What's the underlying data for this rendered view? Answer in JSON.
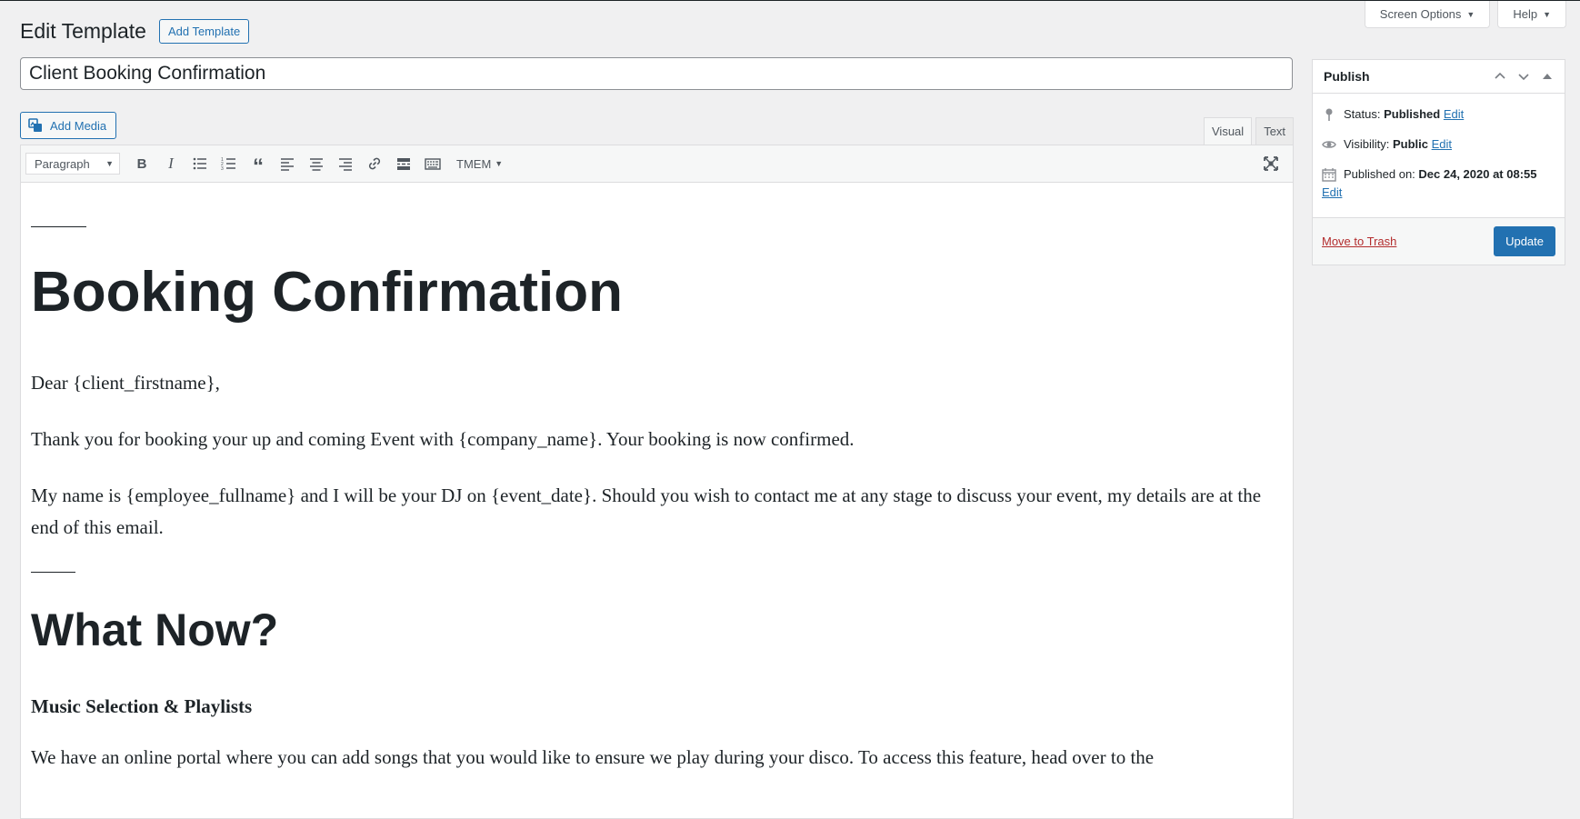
{
  "screen_meta": {
    "screen_options": "Screen Options",
    "help": "Help"
  },
  "header": {
    "title": "Edit Template",
    "add_new": "Add Template"
  },
  "post_title": "Client Booking Confirmation",
  "editor": {
    "add_media": "Add Media",
    "tabs": {
      "visual": "Visual",
      "text": "Text"
    },
    "format_select": "Paragraph",
    "tmem": "TMEM",
    "content": {
      "h1": "Booking Confirmation",
      "p1": "Dear {client_firstname},",
      "p2": "Thank you for booking your up and coming Event with {company_name}. Your booking is now confirmed.",
      "p3": "My name is {employee_fullname} and I will be your DJ on {event_date}. Should you wish to contact me at any stage to discuss your event, my details are at the end of this email.",
      "h2": "What Now?",
      "h3": "Music Selection & Playlists",
      "p4": "We have an online portal where you can add songs that you would like to ensure we play during your disco. To access this feature, head over to the"
    }
  },
  "publish": {
    "title": "Publish",
    "status_label": "Status:",
    "status_value": "Published",
    "visibility_label": "Visibility:",
    "visibility_value": "Public",
    "published_label": "Published on:",
    "published_value": "Dec 24, 2020 at 08:55",
    "edit": "Edit",
    "trash": "Move to Trash",
    "update": "Update"
  }
}
